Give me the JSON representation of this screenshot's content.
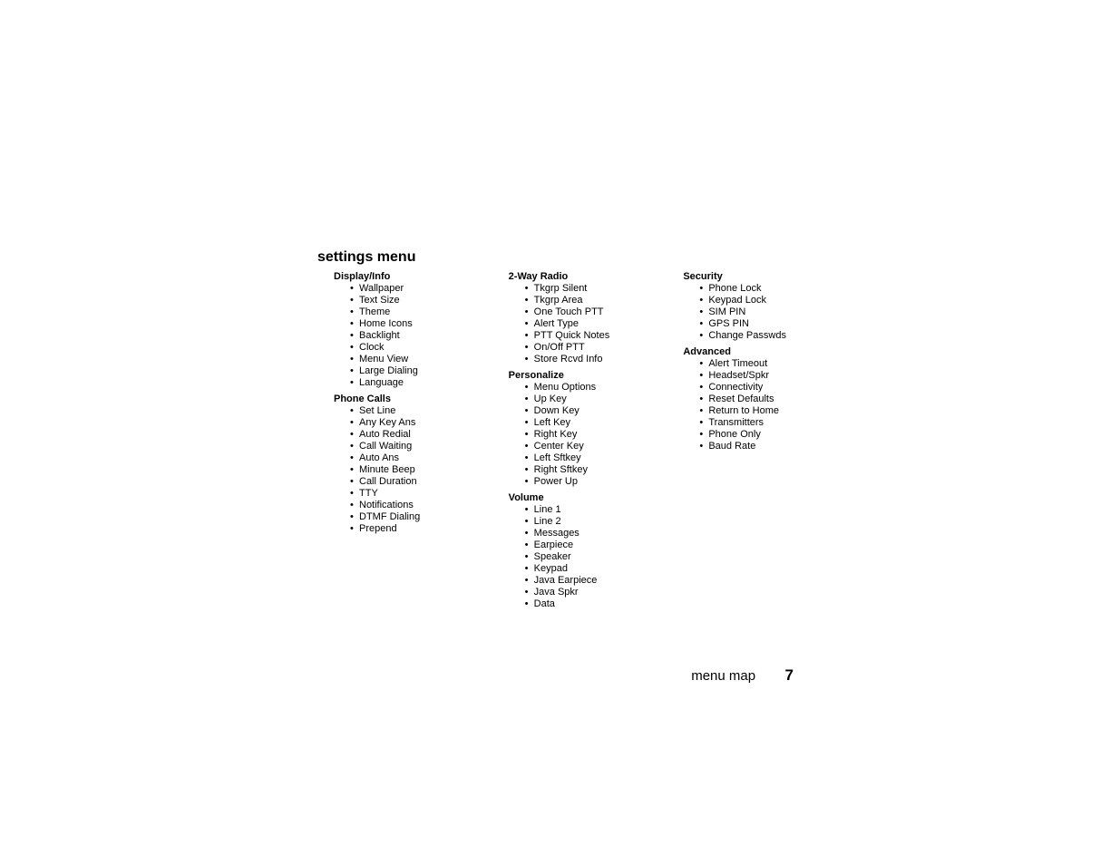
{
  "title": "settings menu",
  "columns": [
    {
      "groups": [
        {
          "heading": "Display/Info",
          "items": [
            "Wallpaper",
            "Text Size",
            "Theme",
            "Home Icons",
            "Backlight",
            "Clock",
            "Menu View",
            "Large Dialing",
            "Language"
          ]
        },
        {
          "heading": "Phone Calls",
          "items": [
            "Set Line",
            "Any Key Ans",
            "Auto Redial",
            "Call Waiting",
            "Auto Ans",
            "Minute Beep",
            "Call Duration",
            "TTY",
            "Notifications",
            "DTMF Dialing",
            "Prepend"
          ]
        }
      ]
    },
    {
      "groups": [
        {
          "heading": "2-Way Radio",
          "items": [
            "Tkgrp Silent",
            "Tkgrp Area",
            "One Touch PTT",
            "Alert Type",
            "PTT Quick Notes",
            "On/Off PTT",
            "Store Rcvd Info"
          ]
        },
        {
          "heading": "Personalize",
          "items": [
            "Menu Options",
            "Up Key",
            "Down Key",
            "Left Key",
            "Right Key",
            "Center Key",
            "Left Sftkey",
            "Right Sftkey",
            "Power Up"
          ]
        },
        {
          "heading": "Volume",
          "items": [
            "Line 1",
            "Line 2",
            "Messages",
            "Earpiece",
            "Speaker",
            "Keypad",
            "Java Earpiece",
            "Java Spkr",
            "Data"
          ]
        }
      ]
    },
    {
      "groups": [
        {
          "heading": "Security",
          "items": [
            "Phone Lock",
            "Keypad Lock",
            "SIM PIN",
            "GPS PIN",
            "Change Passwds"
          ]
        },
        {
          "heading": "Advanced",
          "items": [
            "Alert Timeout",
            "Headset/Spkr",
            "Connectivity",
            "Reset Defaults",
            "Return to Home",
            "Transmitters",
            "Phone Only",
            "Baud Rate"
          ]
        }
      ]
    }
  ],
  "footer": {
    "section": "menu map",
    "page_number": "7"
  }
}
